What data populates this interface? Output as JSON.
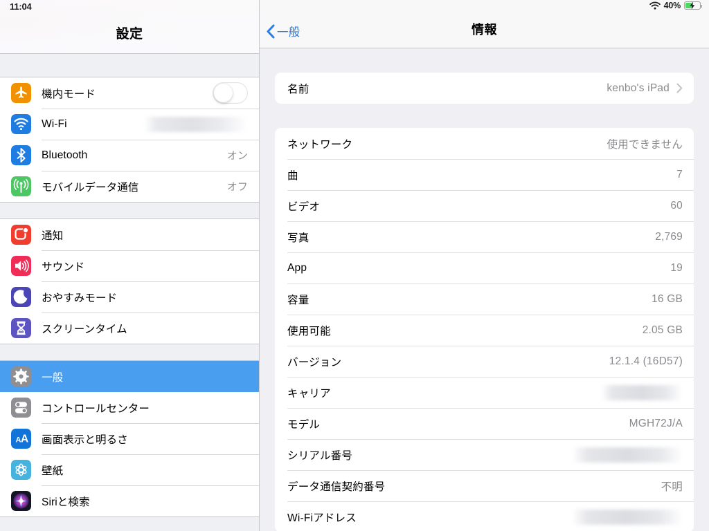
{
  "status_bar": {
    "time": "11:04",
    "wifi_icon": "wifi-icon",
    "battery_percent": "40%",
    "battery_icon": "battery-charging-icon"
  },
  "sidebar": {
    "title": "設定",
    "groups": [
      {
        "items": [
          {
            "label": "機内モード",
            "icon": "airplane-icon",
            "accessory": "toggle",
            "toggle_on": false,
            "value": ""
          },
          {
            "label": "Wi-Fi",
            "icon": "wifi-icon",
            "accessory": "redacted",
            "value": ""
          },
          {
            "label": "Bluetooth",
            "icon": "bluetooth-icon",
            "accessory": "value",
            "value": "オン"
          },
          {
            "label": "モバイルデータ通信",
            "icon": "cellular-icon",
            "accessory": "value",
            "value": "オフ"
          }
        ]
      },
      {
        "items": [
          {
            "label": "通知",
            "icon": "notifications-icon",
            "accessory": "none",
            "value": ""
          },
          {
            "label": "サウンド",
            "icon": "sound-icon",
            "accessory": "none",
            "value": ""
          },
          {
            "label": "おやすみモード",
            "icon": "moon-icon",
            "accessory": "none",
            "value": ""
          },
          {
            "label": "スクリーンタイム",
            "icon": "hourglass-icon",
            "accessory": "none",
            "value": ""
          }
        ]
      },
      {
        "items": [
          {
            "label": "一般",
            "icon": "gear-icon",
            "accessory": "none",
            "value": "",
            "selected": true
          },
          {
            "label": "コントロールセンター",
            "icon": "control-center-icon",
            "accessory": "none",
            "value": ""
          },
          {
            "label": "画面表示と明るさ",
            "icon": "display-brightness-icon",
            "accessory": "none",
            "value": ""
          },
          {
            "label": "壁紙",
            "icon": "wallpaper-icon",
            "accessory": "none",
            "value": ""
          },
          {
            "label": "Siriと検索",
            "icon": "siri-icon",
            "accessory": "none",
            "value": ""
          }
        ]
      }
    ]
  },
  "detail": {
    "back_label": "一般",
    "back_icon": "chevron-left-icon",
    "title": "情報",
    "cards": [
      {
        "rows": [
          {
            "label": "名前",
            "value": "kenbo's iPad",
            "accessory": "chevron"
          }
        ]
      },
      {
        "rows": [
          {
            "label": "ネットワーク",
            "value": "使用できません",
            "accessory": "value"
          },
          {
            "label": "曲",
            "value": "7",
            "accessory": "value"
          },
          {
            "label": "ビデオ",
            "value": "60",
            "accessory": "value"
          },
          {
            "label": "写真",
            "value": "2,769",
            "accessory": "value"
          },
          {
            "label": "App",
            "value": "19",
            "accessory": "value"
          },
          {
            "label": "容量",
            "value": "16 GB",
            "accessory": "value"
          },
          {
            "label": "使用可能",
            "value": "2.05 GB",
            "accessory": "value"
          },
          {
            "label": "バージョン",
            "value": "12.1.4 (16D57)",
            "accessory": "value"
          },
          {
            "label": "キャリア",
            "value": "",
            "accessory": "redacted-short"
          },
          {
            "label": "モデル",
            "value": "MGH72J/A",
            "accessory": "value"
          },
          {
            "label": "シリアル番号",
            "value": "",
            "accessory": "redacted"
          },
          {
            "label": "データ通信契約番号",
            "value": "不明",
            "accessory": "value"
          },
          {
            "label": "Wi-Fiアドレス",
            "value": "",
            "accessory": "redacted"
          }
        ]
      }
    ]
  },
  "colors": {
    "accent_selected": "#4a9ef0",
    "link_blue": "#2b7ce0",
    "battery_green": "#4cd662",
    "panel_bg": "#efeff4",
    "sidebar_bg": "#eff0f4",
    "value_gray": "#8a8a8f"
  }
}
